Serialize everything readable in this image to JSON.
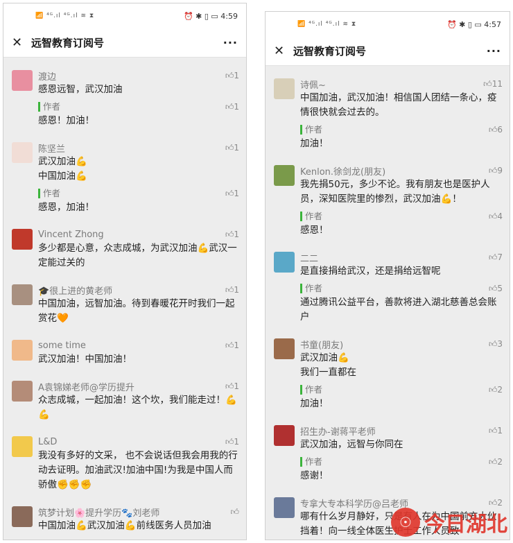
{
  "left": {
    "status": {
      "icons": "📶 ⁴ᴳ.ıl ⁴ᴳ.ıl ≋ ⧗",
      "right_icons": "⏰ ✱ ▯ ▭",
      "time": "4:59"
    },
    "nav": {
      "title": "远智教育订阅号",
      "close": "✕",
      "more": "···"
    },
    "comments": [
      {
        "name": "渡边",
        "likes": "1",
        "text": "感恩远智，武汉加油",
        "reply": {
          "label": "作者",
          "likes": "1",
          "text": "感恩！加油！"
        },
        "avatar_color": "#e88fa0"
      },
      {
        "name": "陈坚兰",
        "likes": "1",
        "text": "武汉加油💪\n中国加油💪",
        "reply": {
          "label": "作者",
          "likes": "1",
          "text": "感恩，加油！"
        },
        "avatar_color": "#f1ddd6"
      },
      {
        "name": "Vincent Zhong",
        "likes": "1",
        "text": "多少都是心意，众志成城，为武汉加油💪武汉一定能过关的",
        "reply": null,
        "avatar_color": "#c0392b"
      },
      {
        "name": "🎓很上进的黄老师",
        "likes": "1",
        "text": "中国加油，远智加油。待到春暖花开时我们一起赏花🧡",
        "reply": null,
        "avatar_color": "#a89080"
      },
      {
        "name": "some time",
        "likes": "1",
        "text": "武汉加油！中国加油！",
        "reply": null,
        "avatar_color": "#f0b98a"
      },
      {
        "name": "A袁锦娣老师@学历提升",
        "likes": "1",
        "text": "众志成城，一起加油！这个坎，我们能走过！💪💪",
        "reply": null,
        "avatar_color": "#b48c78"
      },
      {
        "name": "L&D",
        "likes": "1",
        "text": "我没有多好的文采， 也不会说话但我会用我的行动去证明。加油武汉!加油中国!为我是中国人而骄傲✊✊✊",
        "reply": null,
        "avatar_color": "#f2c94c"
      },
      {
        "name": "筑梦计划🌸提升学历🐾刘老师",
        "likes": "",
        "text": "中国加油💪武汉加油💪前线医务人员加油",
        "reply": null,
        "avatar_color": "#8a6a5a"
      }
    ]
  },
  "right": {
    "status": {
      "icons": "📶 ⁴ᴳ.ıl ⁴ᴳ.ıl ≋ ⧗",
      "right_icons": "⏰ ✱ ▯ ▭",
      "time": "4:57"
    },
    "nav": {
      "title": "远智教育订阅号",
      "close": "✕",
      "more": "···"
    },
    "comments": [
      {
        "name": "诗佩~",
        "likes": "11",
        "text": "中国加油，武汉加油！相信国人团结一条心，疫情很快就会过去的。",
        "reply": {
          "label": "作者",
          "likes": "6",
          "text": "加油！"
        },
        "avatar_color": "#d8cfb8"
      },
      {
        "name": "Kenlon.徐剑龙(朋友)",
        "likes": "9",
        "text": "我先捐50元，多少不论。我有朋友也是医护人员，深知医院里的惨烈，武汉加油💪！",
        "reply": {
          "label": "作者",
          "likes": "4",
          "text": "感恩！"
        },
        "avatar_color": "#7a9a4a"
      },
      {
        "name": "二二",
        "likes": "7",
        "text": "是直接捐给武汉，还是捐给远智呢",
        "reply": {
          "label": "作者",
          "likes": "5",
          "text": "通过腾讯公益平台，善款将进入湖北慈善总会账户"
        },
        "avatar_color": "#5aa8c8"
      },
      {
        "name": "书童(朋友)",
        "likes": "3",
        "text": "武汉加油💪\n我们一直都在",
        "reply": {
          "label": "作者",
          "likes": "2",
          "text": "加油！"
        },
        "avatar_color": "#9a6a4a"
      },
      {
        "name": "招生办-谢蒋平老师",
        "likes": "1",
        "text": "武汉加油，远智与你同在",
        "reply": {
          "label": "作者",
          "likes": "2",
          "text": "感谢！"
        },
        "avatar_color": "#b03030"
      },
      {
        "name": "专拿大专本科学历@吕老师",
        "likes": "2",
        "text": "哪有什么岁月静好，只是有人在为中国前方大伙挡着！向一线全体医生护士工作人员致",
        "reply": null,
        "avatar_color": "#6a7a9a"
      }
    ]
  },
  "watermark": {
    "text": "今日湖北"
  }
}
